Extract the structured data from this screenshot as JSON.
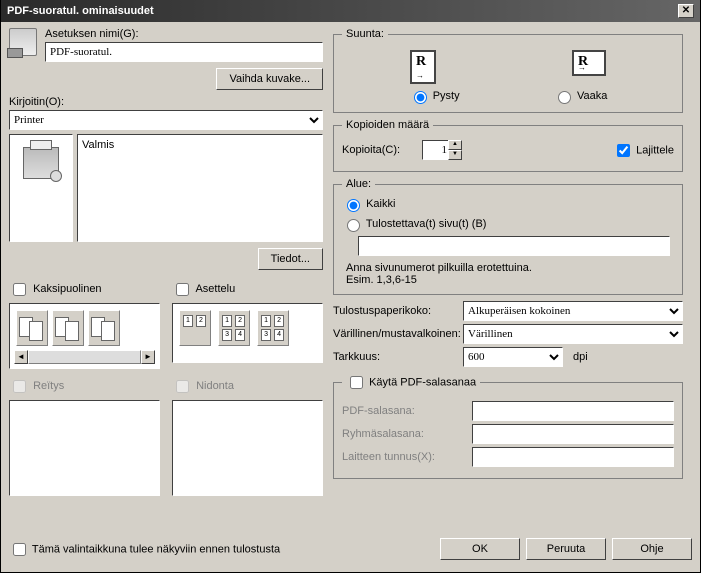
{
  "title": "PDF-suoratul. ominaisuudet",
  "setting_name_label": "Asetuksen nimi(G):",
  "setting_name_value": "PDF-suoratul.",
  "change_icon": "Vaihda kuvake...",
  "printer_label": "Kirjoitin(O):",
  "printer_value": "Printer",
  "status_text": "Valmis",
  "details_btn": "Tiedot...",
  "duplex_label": "Kaksipuolinen",
  "layout_label": "Asettelu",
  "punch_label": "Reïtys",
  "staple_label": "Nidonta",
  "direction": {
    "legend": "Suunta:",
    "portrait": "Pysty",
    "landscape": "Vaaka",
    "selected": "portrait"
  },
  "copies": {
    "legend": "Kopioiden määrä",
    "label": "Kopioita(C):",
    "value": "1",
    "collate": "Lajittele"
  },
  "range": {
    "legend": "Alue:",
    "all": "Kaikki",
    "pages": "Tulostettava(t) sivu(t) (B)",
    "hint1": "Anna sivunumerot pilkuilla erotettuina.",
    "hint2": "Esim. 1,3,6-15"
  },
  "paper_size_label": "Tulostuspaperikoko:",
  "paper_size_value": "Alkuperäisen kokoinen",
  "color_label": "Värillinen/mustavalkoinen:",
  "color_value": "Värillinen",
  "resolution_label": "Tarkkuus:",
  "resolution_value": "600",
  "resolution_unit": "dpi",
  "pdf_pass_enable": "Käytä PDF-salasanaa",
  "pdf_pass_label": "PDF-salasana:",
  "group_pass_label": "Ryhmäsalasana:",
  "device_id_label": "Laitteen tunnus(X):",
  "show_before_print": "Tämä valintaikkuna tulee näkyviin ennen tulostusta",
  "ok": "OK",
  "cancel": "Peruuta",
  "help": "Ohje"
}
